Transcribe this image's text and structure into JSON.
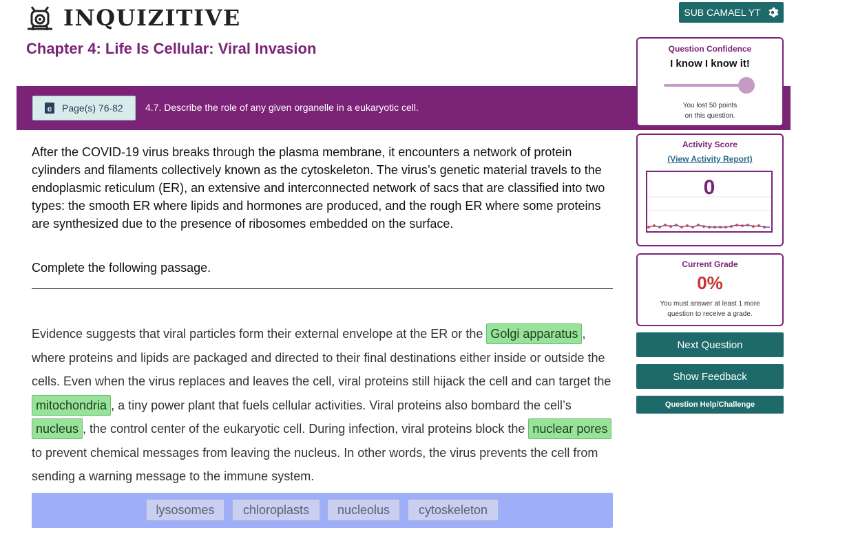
{
  "header": {
    "brand": "InQuizitive",
    "user_button": "SUB CAMAEL YT"
  },
  "chapter": {
    "title": "Chapter 4: Life Is Cellular: Viral Invasion"
  },
  "objective_bar": {
    "pages_label": "Page(s) 76-82",
    "objective": "4.7. Describe the role of any given organelle in a eukaryotic cell."
  },
  "question": {
    "intro": "After the COVID-19 virus breaks through the plasma membrane, it encounters a network of protein cylinders and filaments collectively known as the cytoskeleton. The virus’s genetic material travels to the endoplasmic reticulum (ER), an extensive and interconnected network of sacs that are classified into two types: the smooth ER where lipids and hormones are produced, and the rough ER where some proteins are synthesized due to the presence of ribosomes embedded on the surface.",
    "instruction": "Complete the following passage.",
    "passage": {
      "seg1": "Evidence suggests that viral particles form their external envelope at the ER or the ",
      "blank1": "Golgi apparatus",
      "seg2": ", where proteins and lipids are packaged and directed to their final destinations either inside or outside the cells. Even when the virus replaces and leaves the cell, viral proteins still hijack the cell and can target the ",
      "blank2": "mitochondria",
      "seg3": ", a tiny power plant that fuels cellular activities. Viral proteins also bombard the cell’s ",
      "blank3": "nucleus",
      "seg4": ", the control center of the eukaryotic cell. During infection, viral proteins block the ",
      "blank4": "nuclear pores",
      "seg5": " to prevent chemical messages from leaving the nucleus. In other words, the virus prevents the cell from sending a warning message to the immune system."
    },
    "word_bank": [
      "lysosomes",
      "chloroplasts",
      "nucleolus",
      "cytoskeleton"
    ]
  },
  "sidebar": {
    "confidence": {
      "title": "Question Confidence",
      "value": "I know I know it!",
      "level": 1.0,
      "note_line1": "You lost 50 points",
      "note_line2": "on this question."
    },
    "activity": {
      "title": "Activity Score",
      "link": "(View Activity Report)",
      "score": "0"
    },
    "grade": {
      "title": "Current Grade",
      "value": "0%",
      "note_line1": "You must answer at least 1 more",
      "note_line2": "question to receive a grade."
    },
    "buttons": {
      "next": "Next Question",
      "feedback": "Show Feedback",
      "help": "Question Help/Challenge"
    }
  },
  "colors": {
    "purple": "#7a2377",
    "teal": "#1e6a6a",
    "blank_green": "#98e39a",
    "word_bank_bg": "#9eaef8",
    "grade_red": "#c9332f"
  }
}
